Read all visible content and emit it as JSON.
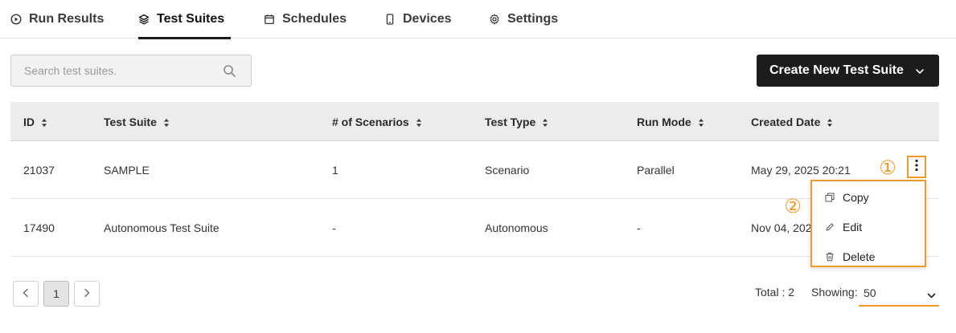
{
  "tabs": [
    {
      "label": "Run Results",
      "icon": "play-circle-icon",
      "active": false
    },
    {
      "label": "Test Suites",
      "icon": "layers-icon",
      "active": true
    },
    {
      "label": "Schedules",
      "icon": "calendar-icon",
      "active": false
    },
    {
      "label": "Devices",
      "icon": "mobile-icon",
      "active": false
    },
    {
      "label": "Settings",
      "icon": "gear-icon",
      "active": false
    }
  ],
  "search": {
    "placeholder": "Search test suites.",
    "value": ""
  },
  "create_button": {
    "label": "Create New Test Suite"
  },
  "table": {
    "columns": [
      "ID",
      "Test Suite",
      "# of Scenarios",
      "Test Type",
      "Run Mode",
      "Created Date"
    ],
    "rows": [
      {
        "id": "21037",
        "name": "SAMPLE",
        "scenarios": "1",
        "type": "Scenario",
        "mode": "Parallel",
        "created": "May 29, 2025 20:21"
      },
      {
        "id": "17490",
        "name": "Autonomous Test Suite",
        "scenarios": "-",
        "type": "Autonomous",
        "mode": "-",
        "created": "Nov 04, 202"
      }
    ]
  },
  "callouts": [
    "①",
    "②"
  ],
  "menu": {
    "items": [
      {
        "label": "Copy",
        "icon": "copy-icon"
      },
      {
        "label": "Edit",
        "icon": "pencil-icon"
      },
      {
        "label": "Delete",
        "icon": "trash-icon"
      }
    ]
  },
  "pagination": {
    "current_page": "1",
    "total_label": "Total : 2",
    "showing_label": "Showing:",
    "page_size": "50"
  },
  "colors": {
    "accent": "#ef9a2a",
    "button_dark": "#1c1c1c",
    "header_bg": "#ececec"
  }
}
